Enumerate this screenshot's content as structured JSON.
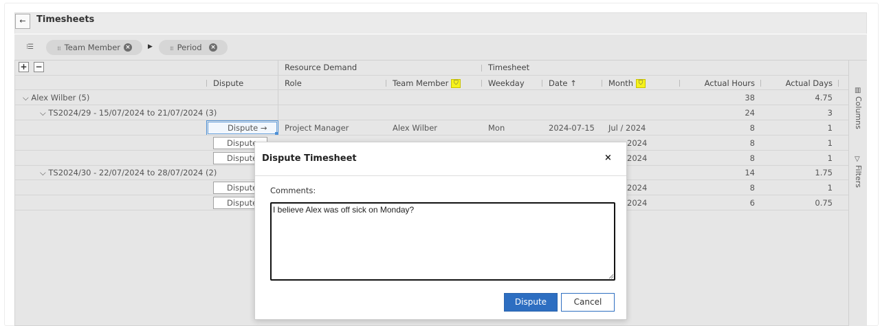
{
  "header": {
    "title": "Timesheets",
    "back_icon": "arrow-left-icon"
  },
  "grouping": {
    "chips": [
      {
        "label": "Team Member"
      },
      {
        "label": "Period"
      }
    ]
  },
  "side_panel": {
    "columns_label": "Columns",
    "filters_label": "Filters"
  },
  "column_groups": {
    "resource_demand": "Resource Demand",
    "timesheet": "Timesheet"
  },
  "columns": {
    "dispute": "Dispute",
    "role": "Role",
    "team_member": "Team Member",
    "weekday": "Weekday",
    "date": "Date",
    "month": "Month",
    "actual_hours": "Actual Hours",
    "actual_days": "Actual Days"
  },
  "controls": {
    "expand": "+",
    "collapse": "−"
  },
  "groups": {
    "alex": {
      "label": "Alex Wilber (5)",
      "hours": "38",
      "days": "4.75"
    },
    "ts29": {
      "label": "TS2024/29 - 15/07/2024 to 21/07/2024 (3)",
      "hours": "24",
      "days": "3"
    },
    "ts30": {
      "label": "TS2024/30 - 22/07/2024 to 28/07/2024 (2)",
      "hours": "14",
      "days": "1.75"
    }
  },
  "rows": [
    {
      "dispute": "Dispute",
      "dispute_arrow": "→",
      "role": "Project Manager",
      "team_member": "Alex Wilber",
      "weekday": "Mon",
      "date": "2024-07-15",
      "month": "Jul / 2024",
      "hours": "8",
      "days": "1"
    },
    {
      "dispute": "Dispute",
      "month": "2024",
      "hours": "8",
      "days": "1"
    },
    {
      "dispute": "Dispute",
      "month": "2024",
      "hours": "8",
      "days": "1"
    },
    {
      "dispute": "Dispute",
      "month": "2024",
      "hours": "8",
      "days": "1"
    },
    {
      "dispute": "Dispute",
      "month": "2024",
      "hours": "6",
      "days": "0.75"
    }
  ],
  "modal": {
    "title": "Dispute Timesheet",
    "close": "×",
    "comments_label": "Comments:",
    "comments_value": "I believe Alex was off sick on Monday?",
    "primary_button": "Dispute",
    "secondary_button": "Cancel"
  },
  "colors": {
    "accent": "#2d6ec1",
    "filter_active": "#f6f21c",
    "grid_bg": "#e6e6e6"
  }
}
